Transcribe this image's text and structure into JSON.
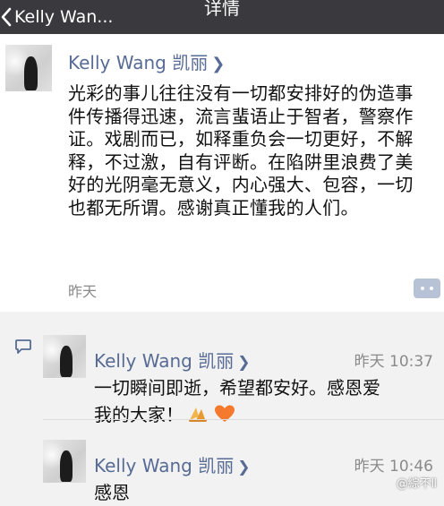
{
  "nav": {
    "back_label": "Kelly Wan...",
    "title": "详情"
  },
  "post": {
    "author": "Kelly Wang 凯丽",
    "text": "光彩的事儿往往没有一切都安排好的伪造事件传播得迅速，流言蜚语止于智者，警察作证。戏剧而已，如释重负会一切更好，不解释，不过激，自有评断。在陷阱里浪费了美好的光阴毫无意义，内心强大、包容，一切也都无所谓。感谢真正懂我的人们。",
    "time": "昨天"
  },
  "comments": [
    {
      "author": "Kelly Wang 凯丽",
      "time": "昨天 10:37",
      "text": "一切瞬间即逝，希望都安好。感恩爱我的大家！",
      "emojis": [
        "folded-hands-emoji",
        "orange-heart-emoji"
      ]
    },
    {
      "author": "Kelly Wang 凯丽",
      "time": "昨天 10:46",
      "text": "感恩"
    }
  ],
  "colors": {
    "navbar": "#39393e",
    "name_link": "#576b95",
    "time_text": "#8a8a8a",
    "comment_button": "#b7c2d6"
  },
  "watermark": "@綜不Ⅱ"
}
